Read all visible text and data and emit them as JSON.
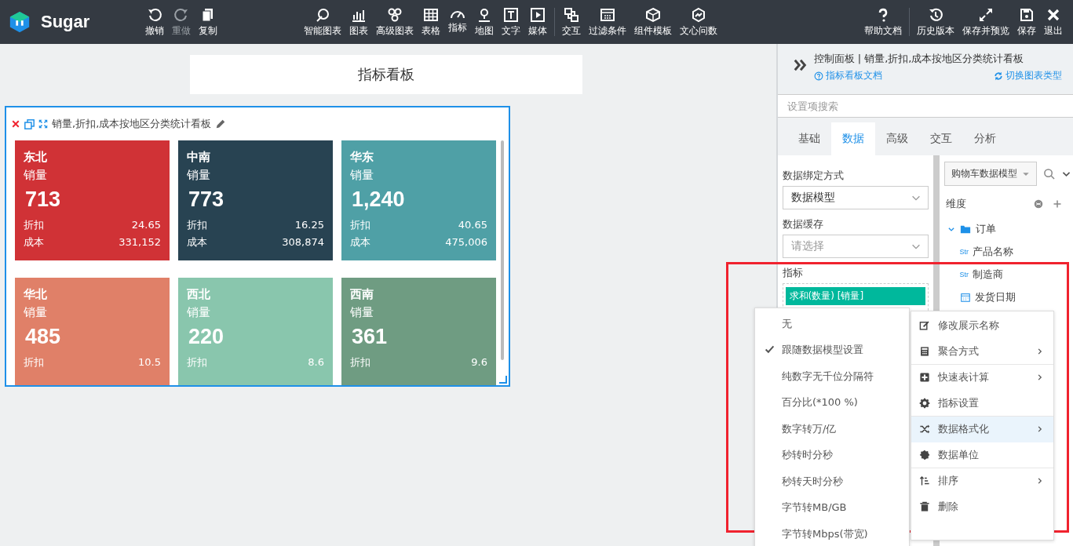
{
  "toolbar": {
    "logo": "Sugar",
    "groups": [
      [
        {
          "label": "撤销",
          "disabled": false
        },
        {
          "label": "重做",
          "disabled": true
        },
        {
          "label": "复制",
          "disabled": false
        }
      ],
      [
        {
          "label": "智能图表",
          "disabled": false
        },
        {
          "label": "图表",
          "disabled": false
        },
        {
          "label": "高级图表",
          "disabled": false
        },
        {
          "label": "表格",
          "disabled": false
        },
        {
          "label": "指标",
          "disabled": false
        },
        {
          "label": "地图",
          "disabled": false
        },
        {
          "label": "文字",
          "disabled": false
        },
        {
          "label": "媒体",
          "disabled": false
        }
      ],
      [
        {
          "label": "交互",
          "disabled": false
        },
        {
          "label": "过滤条件",
          "disabled": false
        },
        {
          "label": "组件模板",
          "disabled": false
        },
        {
          "label": "文心问数",
          "disabled": false
        }
      ],
      [
        {
          "label": "帮助文档",
          "disabled": false
        }
      ],
      [
        {
          "label": "历史版本",
          "disabled": false
        },
        {
          "label": "保存并预览",
          "disabled": false
        },
        {
          "label": "保存",
          "disabled": false
        },
        {
          "label": "退出",
          "disabled": false
        }
      ]
    ]
  },
  "canvas": {
    "page_title": "指标看板",
    "widget": {
      "title": "销量,折扣,成本按地区分类统计看板",
      "cards": [
        {
          "region": "东北",
          "metric": "销量",
          "value": "713",
          "color": "#d03236",
          "rows": [
            {
              "label": "折扣",
              "value": "24.65"
            },
            {
              "label": "成本",
              "value": "331,152"
            }
          ]
        },
        {
          "region": "中南",
          "metric": "销量",
          "value": "773",
          "color": "#284352",
          "rows": [
            {
              "label": "折扣",
              "value": "16.25"
            },
            {
              "label": "成本",
              "value": "308,874"
            }
          ]
        },
        {
          "region": "华东",
          "metric": "销量",
          "value": "1,240",
          "color": "#4fa0a6",
          "rows": [
            {
              "label": "折扣",
              "value": "40.65"
            },
            {
              "label": "成本",
              "value": "475,006"
            }
          ]
        },
        {
          "region": "华北",
          "metric": "销量",
          "value": "485",
          "color": "#e08068",
          "rows": [
            {
              "label": "折扣",
              "value": "10.5"
            }
          ]
        },
        {
          "region": "西北",
          "metric": "销量",
          "value": "220",
          "color": "#89c6ad",
          "rows": [
            {
              "label": "折扣",
              "value": "8.6"
            }
          ]
        },
        {
          "region": "西南",
          "metric": "销量",
          "value": "361",
          "color": "#6f9c82",
          "rows": [
            {
              "label": "折扣",
              "value": "9.6"
            }
          ]
        }
      ]
    }
  },
  "panel": {
    "title": "控制面板 | 销量,折扣,成本按地区分类统计看板",
    "doc_link": "指标看板文档",
    "switch_link": "切换图表类型",
    "search": {
      "placeholder": "设置项搜索"
    },
    "tabs": [
      {
        "label": "基础",
        "selected": false
      },
      {
        "label": "数据",
        "selected": true
      },
      {
        "label": "高级",
        "selected": false
      },
      {
        "label": "交互",
        "selected": false
      },
      {
        "label": "分析",
        "selected": false
      }
    ],
    "binding": {
      "label": "数据绑定方式",
      "value": "数据模型"
    },
    "cache": {
      "label": "数据缓存",
      "placeholder": "请选择"
    },
    "measures": {
      "label": "指标",
      "chips": [
        "求和(数量) [销量]"
      ]
    },
    "model_select": "购物车数据模型",
    "dimensions": {
      "label": "维度",
      "tree": [
        {
          "label": "订单",
          "expanded": true,
          "children": [
            {
              "label": "产品名称",
              "kind": "string",
              "badge": "Str"
            },
            {
              "label": "制造商",
              "kind": "string",
              "badge": "Str"
            },
            {
              "label": "发货日期",
              "kind": "date"
            }
          ]
        }
      ]
    }
  },
  "context_menu": {
    "items": [
      {
        "label": "修改展示名称",
        "submenu": false,
        "selected": false,
        "divider_after": false
      },
      {
        "label": "聚合方式",
        "submenu": true,
        "selected": false,
        "divider_after": true
      },
      {
        "label": "快速表计算",
        "submenu": true,
        "selected": false,
        "divider_after": false
      },
      {
        "label": "指标设置",
        "submenu": false,
        "selected": false,
        "divider_after": true
      },
      {
        "label": "数据格式化",
        "submenu": true,
        "selected": true,
        "divider_after": false
      },
      {
        "label": "数据单位",
        "submenu": false,
        "selected": false,
        "divider_after": true
      },
      {
        "label": "排序",
        "submenu": true,
        "selected": false,
        "divider_after": false
      },
      {
        "label": "删除",
        "submenu": false,
        "selected": false,
        "divider_after": false
      }
    ]
  },
  "format_submenu": {
    "items": [
      {
        "label": "无",
        "selected": false
      },
      {
        "label": "跟随数据模型设置",
        "selected": true
      },
      {
        "label": "纯数字无千位分隔符",
        "selected": false
      },
      {
        "label": "百分比(*100 %)",
        "selected": false
      },
      {
        "label": "数字转万/亿",
        "selected": false
      },
      {
        "label": "秒转时分秒",
        "selected": false
      },
      {
        "label": "秒转天时分秒",
        "selected": false
      },
      {
        "label": "字节转MB/GB",
        "selected": false
      },
      {
        "label": "字节转Mbps(带宽)",
        "selected": false
      }
    ]
  }
}
